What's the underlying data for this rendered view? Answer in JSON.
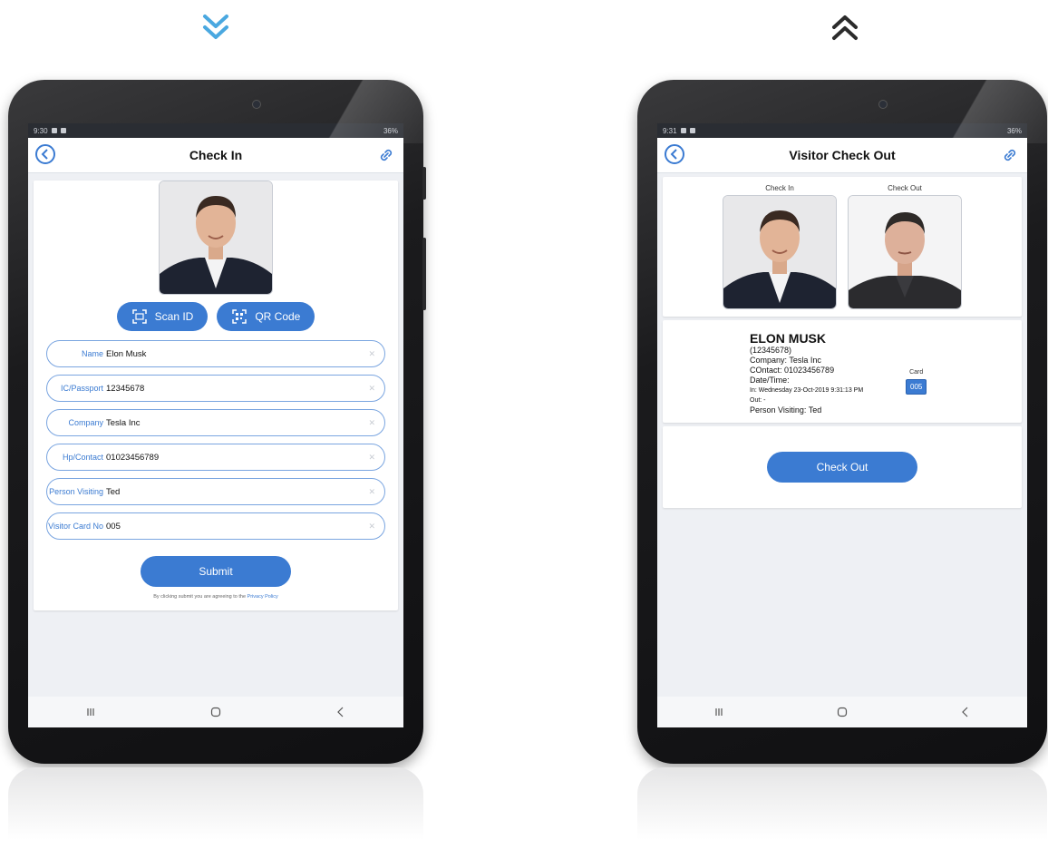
{
  "left_device": {
    "status": {
      "time": "9:30",
      "battery": "36%"
    },
    "title": "Check In",
    "buttons": {
      "scan_id": "Scan ID",
      "qr_code": "QR Code"
    },
    "fields": [
      {
        "label": "Name",
        "value": "Elon Musk"
      },
      {
        "label": "IC/Passport",
        "value": "12345678"
      },
      {
        "label": "Company",
        "value": "Tesla Inc"
      },
      {
        "label": "Hp/Contact",
        "value": "01023456789"
      },
      {
        "label": "Person Visiting",
        "value": "Ted"
      },
      {
        "label": "Visitor Card No",
        "value": "005"
      }
    ],
    "submit_label": "Submit",
    "terms_text": "By clicking submit you are agreeing to the",
    "privacy_link": "Privacy Policy"
  },
  "right_device": {
    "status": {
      "time": "9:31",
      "battery": "36%"
    },
    "title": "Visitor Check Out",
    "photo_captions": {
      "check_in": "Check In",
      "check_out": "Check Out"
    },
    "visitor": {
      "name": "ELON MUSK",
      "id": "(12345678)",
      "company": "Company: Tesla Inc",
      "contact": "COntact: 01023456789",
      "datetime_label": "Date/Time:",
      "in_time": "In: Wednesday 23-Oct-2019 9:31:13 PM",
      "out_time": "Out: -",
      "person_visiting": "Person Visiting: Ted"
    },
    "card": {
      "label": "Card",
      "number": "005"
    },
    "checkout_label": "Check Out"
  },
  "icons": {
    "left_arrow": "double-chevron-down-icon",
    "right_arrow": "double-chevron-up-icon",
    "accent": "#3b7bd2"
  }
}
